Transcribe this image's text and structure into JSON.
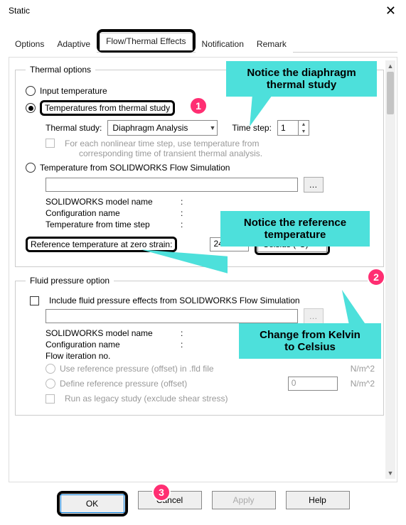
{
  "window": {
    "title": "Static"
  },
  "tabs": {
    "items": [
      "Options",
      "Adaptive",
      "Flow/Thermal Effects",
      "Notification",
      "Remark"
    ],
    "active_index": 2
  },
  "thermal_options": {
    "legend": "Thermal options",
    "input_temp_label": "Input temperature",
    "temp_from_study_label": "Temperatures from thermal study",
    "thermal_study_label": "Thermal study:",
    "thermal_study_value": "Diaphragm Analysis",
    "time_step_label": "Time step:",
    "time_step_value": "1",
    "nonlinear_note_l1": "For each nonlinear time step, use temperature from",
    "nonlinear_note_l2": "corresponding time of transient thermal analysis.",
    "temp_from_flow_label": "Temperature from SOLIDWORKS Flow Simulation",
    "flow_path_value": "",
    "model_name_label": "SOLIDWORKS model name",
    "config_name_label": "Configuration name",
    "temp_from_time_step_label": "Temperature from time step",
    "ref_temp_label": "Reference temperature at zero strain:",
    "ref_temp_value": "24.85",
    "ref_temp_unit": "Celsius (°C)"
  },
  "fluid_options": {
    "legend": "Fluid pressure option",
    "include_label": "Include fluid pressure effects from SOLIDWORKS Flow Simulation",
    "model_name_label": "SOLIDWORKS model name",
    "config_name_label": "Configuration name",
    "flow_iter_label": "Flow iteration no.",
    "use_ref_pressure_label": "Use reference pressure (offset) in .fld file",
    "define_ref_pressure_label": "Define reference pressure (offset)",
    "define_ref_pressure_value": "0",
    "pressure_unit": "N/m^2",
    "run_legacy_label": "Run as legacy study (exclude shear stress)"
  },
  "buttons": {
    "ok": "OK",
    "cancel": "Cancel",
    "apply": "Apply",
    "help": "Help"
  },
  "callouts": {
    "c1_l1": "Notice the diaphragm",
    "c1_l2": "thermal study",
    "c2_l1": "Notice the reference",
    "c2_l2": "temperature",
    "c3_l1": "Change from Kelvin",
    "c3_l2": "to Celsius",
    "b1": "1",
    "b2": "2",
    "b3": "3"
  }
}
